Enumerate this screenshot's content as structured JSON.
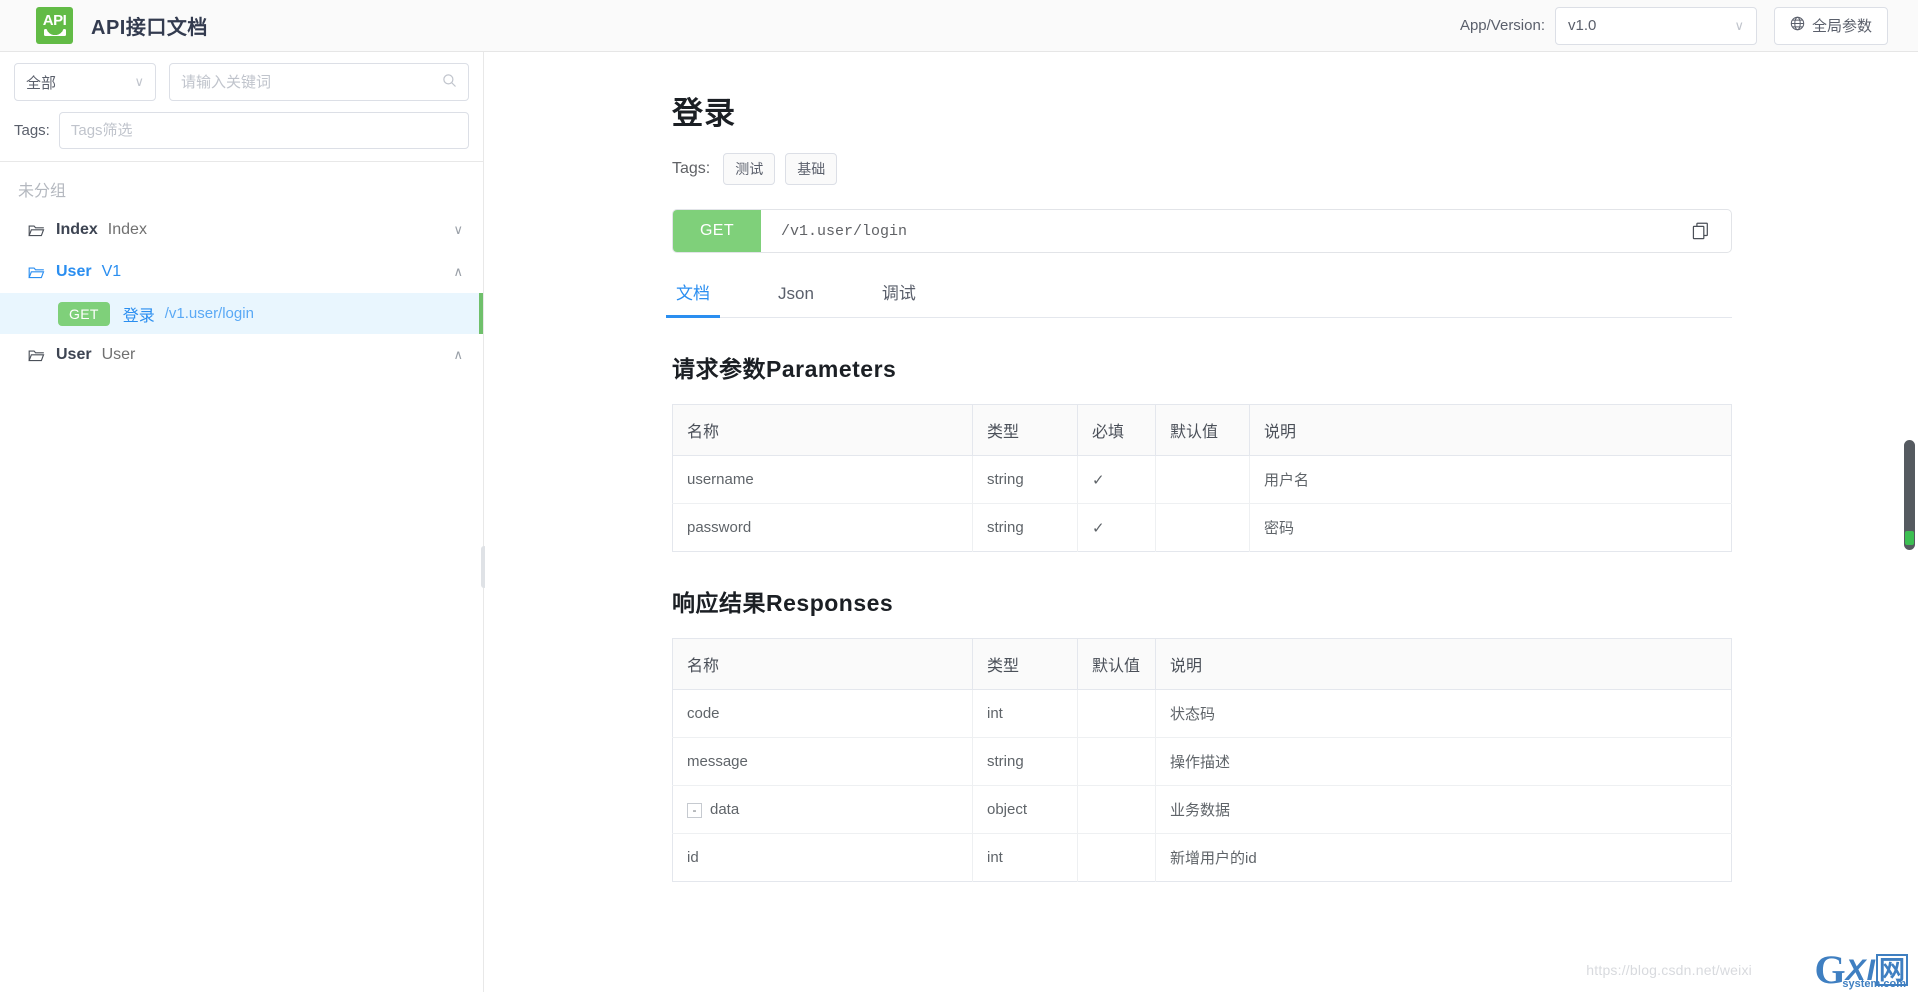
{
  "header": {
    "logo_text": "API",
    "logo_icon": "api-logo-icon",
    "title": "API接口文档",
    "appver_label": "App/Version:",
    "version_value": "v1.0",
    "chevron": "∨",
    "global_params_label": "全局参数",
    "globe_icon": "globe-icon"
  },
  "sidebar": {
    "category_value": "全部",
    "search_placeholder": "请输入关键词",
    "search_value": "",
    "search_icon": "search-icon",
    "tags_label": "Tags:",
    "tags_placeholder": "Tags筛选",
    "tags_value": "",
    "group_title": "未分组",
    "tree": [
      {
        "name": "Index",
        "sub": "Index",
        "caret": "∨",
        "active": false
      },
      {
        "name": "User",
        "sub": "V1",
        "caret": "∧",
        "active": true
      },
      {
        "name": "User",
        "sub": "User",
        "caret": "∧",
        "active": false
      }
    ],
    "api_item": {
      "method": "GET",
      "name": "登录",
      "path": "/v1.user/login"
    }
  },
  "main": {
    "doc_title": "登录",
    "tags_label": "Tags:",
    "tags": [
      "测试",
      "基础"
    ],
    "url": {
      "method": "GET",
      "path": "/v1.user/login",
      "copy_icon": "copy-icon"
    },
    "tabs": [
      {
        "label": "文档",
        "active": true
      },
      {
        "label": "Json",
        "active": false
      },
      {
        "label": "调试",
        "active": false
      }
    ],
    "params_section": {
      "title": "请求参数Parameters",
      "columns": [
        "名称",
        "类型",
        "必填",
        "默认值",
        "说明"
      ],
      "rows": [
        {
          "name": "username",
          "type": "string",
          "required": "✓",
          "default": "",
          "desc": "用户名"
        },
        {
          "name": "password",
          "type": "string",
          "required": "✓",
          "default": "",
          "desc": "密码"
        }
      ]
    },
    "responses_section": {
      "title": "响应结果Responses",
      "columns": [
        "名称",
        "类型",
        "默认值",
        "说明"
      ],
      "rows": [
        {
          "name": "code",
          "type": "int",
          "default": "",
          "desc": "状态码",
          "indent": 1,
          "collapse": ""
        },
        {
          "name": "message",
          "type": "string",
          "default": "",
          "desc": "操作描述",
          "indent": 1,
          "collapse": ""
        },
        {
          "name": "data",
          "type": "object",
          "default": "",
          "desc": "业务数据",
          "indent": 0,
          "collapse": "-"
        },
        {
          "name": "id",
          "type": "int",
          "default": "",
          "desc": "新增用户的id",
          "indent": 2,
          "collapse": ""
        }
      ]
    }
  },
  "watermark": {
    "url": "https://blog.csdn.net/weixi",
    "brand_g": "G",
    "brand_xi": "XI",
    "brand_cn": "网",
    "brand_sys": "system.com"
  },
  "colors": {
    "accent_blue": "#2a8ef0",
    "method_green": "#7fd07a",
    "logo_green": "#62bb46"
  }
}
